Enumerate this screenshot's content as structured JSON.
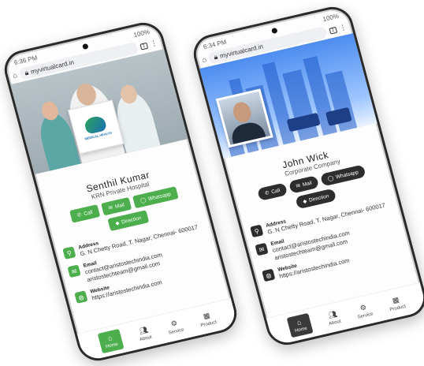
{
  "left": {
    "status_time": "6:36 PM",
    "url": "myvirtualcard.in",
    "battery": "100%",
    "tab_count": "1",
    "logo_text": "MEDICAL HEALTH",
    "name": "Senthil Kumar",
    "company": "KRN Private Hospital",
    "buttons": [
      "Call",
      "Mail",
      "Whatsapp",
      "Direction"
    ],
    "address_label": "Address",
    "address_value": "G. N Chetty Road, T. Nagar, Chennai- 600017",
    "email_label": "Email",
    "email_value_1": "contact@aristostechindia.com",
    "email_value_2": "aristostechteam@gmail.com",
    "website_label": "Website",
    "website_value": "https://aristostechindia.com",
    "nav": [
      "Home",
      "About",
      "Service",
      "Product"
    ],
    "accent": "#4cae4c"
  },
  "right": {
    "status_time": "6:34 PM",
    "url": "myvirtualcard.in",
    "battery": "100%",
    "tab_count": "1",
    "name": "John Wick",
    "company": "Corporate Company",
    "buttons": [
      "Call",
      "Mail",
      "Whatsapp",
      "Direction"
    ],
    "address_label": "Address",
    "address_value": "G. N Chetty Road, T. Nagar, Chennai- 600017",
    "email_label": "Email",
    "email_value_1": "contact@aristostechindia.com",
    "email_value_2": "aristostechteam@gmail.com",
    "website_label": "Website",
    "website_value": "https://aristostechindia.com",
    "nav": [
      "Home",
      "About",
      "Service",
      "Product"
    ],
    "accent": "#2d2d2d"
  }
}
